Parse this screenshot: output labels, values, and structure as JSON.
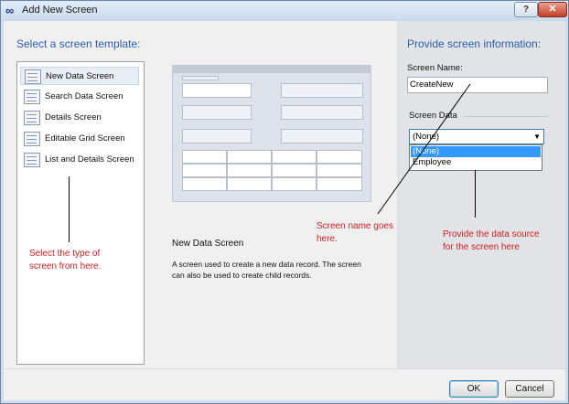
{
  "window": {
    "title": "Add New Screen",
    "help_label": "?",
    "close_label": "✕"
  },
  "left": {
    "heading": "Select a screen template:",
    "templates": [
      {
        "label": "New Data Screen",
        "selected": true
      },
      {
        "label": "Search Data Screen"
      },
      {
        "label": "Details Screen"
      },
      {
        "label": "Editable Grid Screen"
      },
      {
        "label": "List and Details Screen"
      }
    ],
    "preview_title": "New Data Screen",
    "preview_description": "A screen used to create a new data record.  The screen can also be used to create child records."
  },
  "right": {
    "heading": "Provide screen information:",
    "screen_name_label": "Screen Name:",
    "screen_name_value": "CreateNew",
    "screen_data_label": "Screen Data",
    "screen_data_selected": "(None)",
    "screen_data_options": [
      "(None)",
      "Employee"
    ]
  },
  "annotations": {
    "select_type": "Select the type of screen from here.",
    "screen_name": "Screen name goes here.",
    "data_source": "Provide the data source for the screen here"
  },
  "footer": {
    "ok_label": "OK",
    "cancel_label": "Cancel"
  },
  "colors": {
    "heading": "#2a5db0",
    "annotation": "#cc1f1f",
    "selection": "#3399ff"
  }
}
